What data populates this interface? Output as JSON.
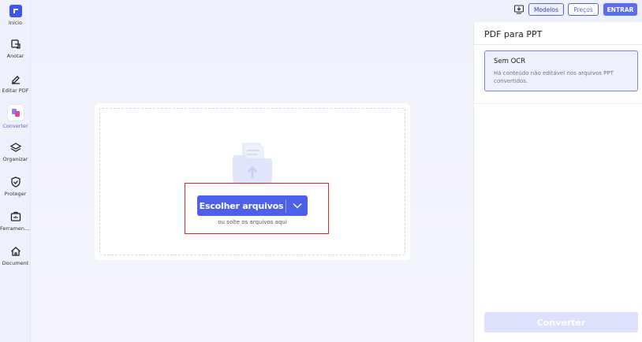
{
  "sidebar": {
    "items": [
      {
        "label": "Início",
        "icon": "logo-icon"
      },
      {
        "label": "Anotar",
        "icon": "annotate-icon"
      },
      {
        "label": "Editar PDF",
        "icon": "edit-pen-icon"
      },
      {
        "label": "Converter",
        "icon": "convert-icon"
      },
      {
        "label": "Organizar",
        "icon": "layers-icon"
      },
      {
        "label": "Proteger",
        "icon": "shield-icon"
      },
      {
        "label": "Ferramentas",
        "icon": "toolbox-icon"
      },
      {
        "label": "Document",
        "icon": "home-icon"
      }
    ]
  },
  "topbar": {
    "download_icon": "download-icon",
    "modelos_label": "Modelos",
    "precos_label": "Preços",
    "entrar_label": "ENTRAR"
  },
  "upload": {
    "choose_label": "Escolher arquivos",
    "drop_hint": "ou solte os arquivos aqui"
  },
  "panel": {
    "title": "PDF para PPT",
    "ocr_title": "Sem OCR",
    "ocr_desc": "Há conteúdo não editável nos arquivos PPT convertidos.",
    "convert_label": "Converter"
  },
  "colors": {
    "accent": "#4d60e8",
    "sidebar_bg": "#eef0fb",
    "highlight": "#d42a2a",
    "convert_disabled": "#dde1fb"
  }
}
